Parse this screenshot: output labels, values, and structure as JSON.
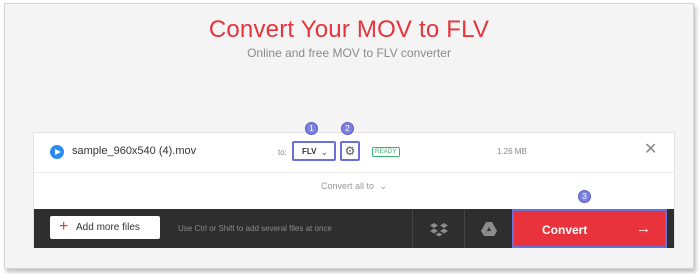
{
  "header": {
    "title": "Convert Your MOV to FLV",
    "subtitle": "Online and free MOV to FLV converter"
  },
  "file": {
    "name": "sample_960x540 (4).mov",
    "to_label": "to:",
    "format": "FLV",
    "status": "READY",
    "size": "1.26 MB"
  },
  "convert_all": {
    "label": "Convert all to"
  },
  "toolbar": {
    "add_label": "Add more files",
    "hint": "Use Ctrl or Shift to add several files at once",
    "convert_label": "Convert"
  },
  "steps": [
    "1",
    "2",
    "3"
  ],
  "colors": {
    "accent": "#e8333c",
    "highlight": "#6b6fd6",
    "toolbar": "#2e2e2e",
    "ready": "#3cb371"
  }
}
